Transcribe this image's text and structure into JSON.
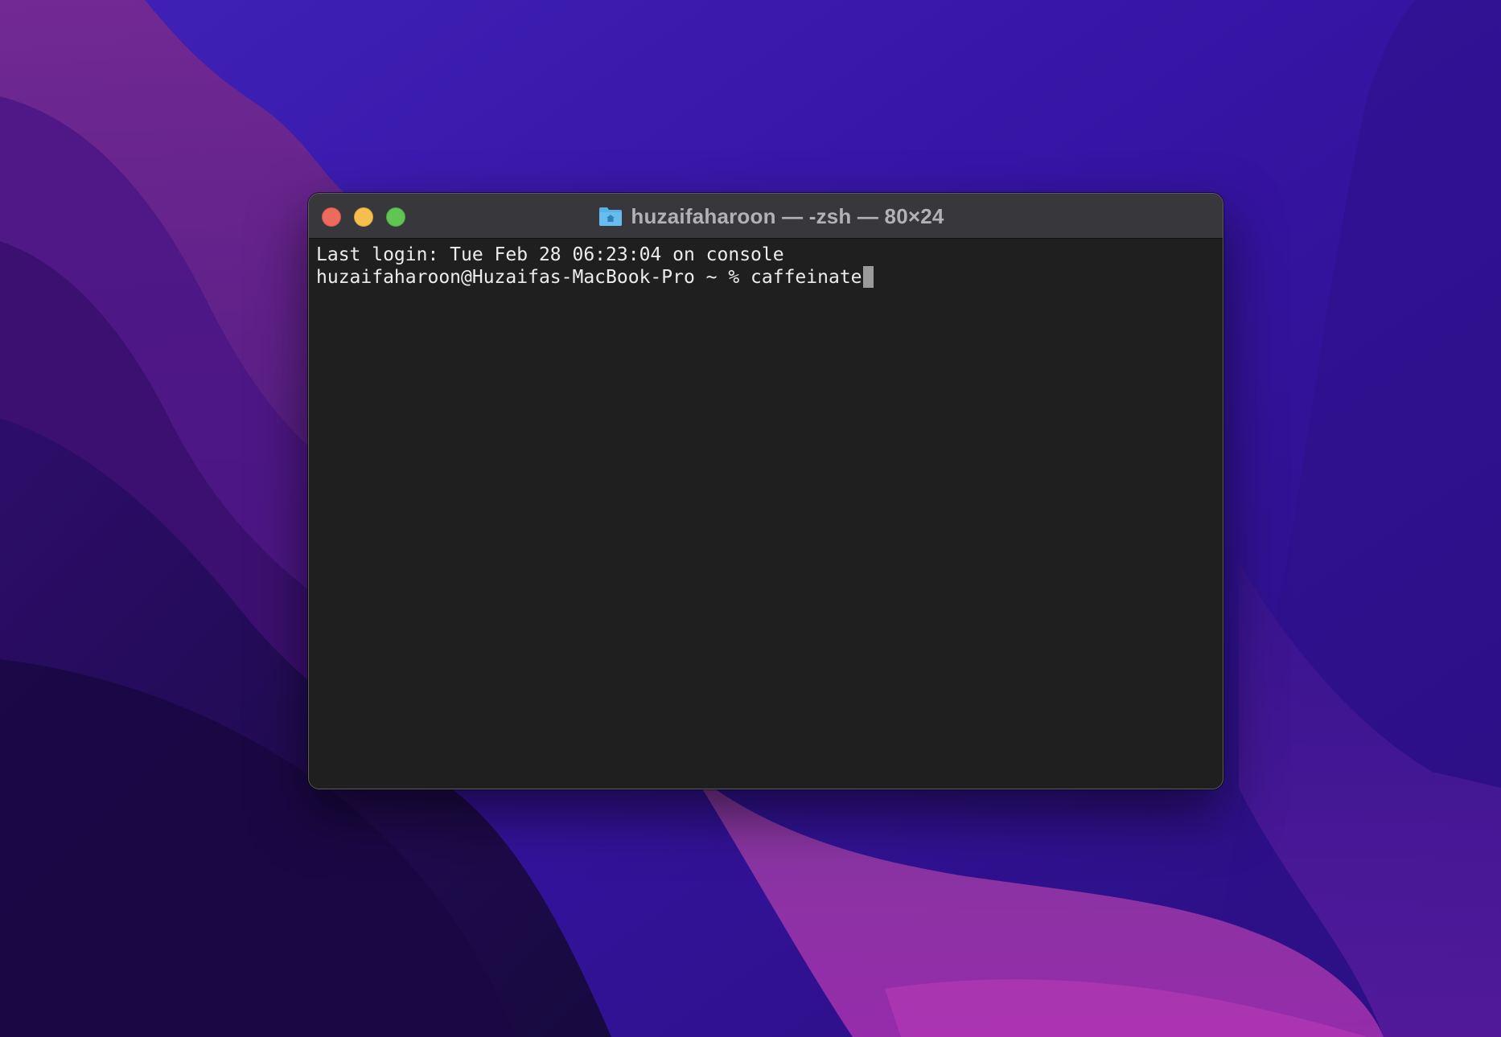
{
  "window": {
    "title": "huzaifaharoon — -zsh — 80×24",
    "title_icon": "home-folder-icon",
    "buttons": {
      "close": "close-button",
      "minimize": "minimize-button",
      "zoom": "zoom-button"
    }
  },
  "terminal": {
    "last_login": "Last login: Tue Feb 28 06:23:04 on console",
    "prompt": "huzaifaharoon@Huzaifas-MacBook-Pro ~ % ",
    "command": "caffeinate"
  },
  "colors": {
    "terminal_background": "#1f1f1f",
    "titlebar_background": "#38373b",
    "text": "#ececec",
    "close": "#ed6a5e",
    "minimize": "#f5bf4f",
    "zoom": "#61c554",
    "folder": "#5ab1e8"
  }
}
